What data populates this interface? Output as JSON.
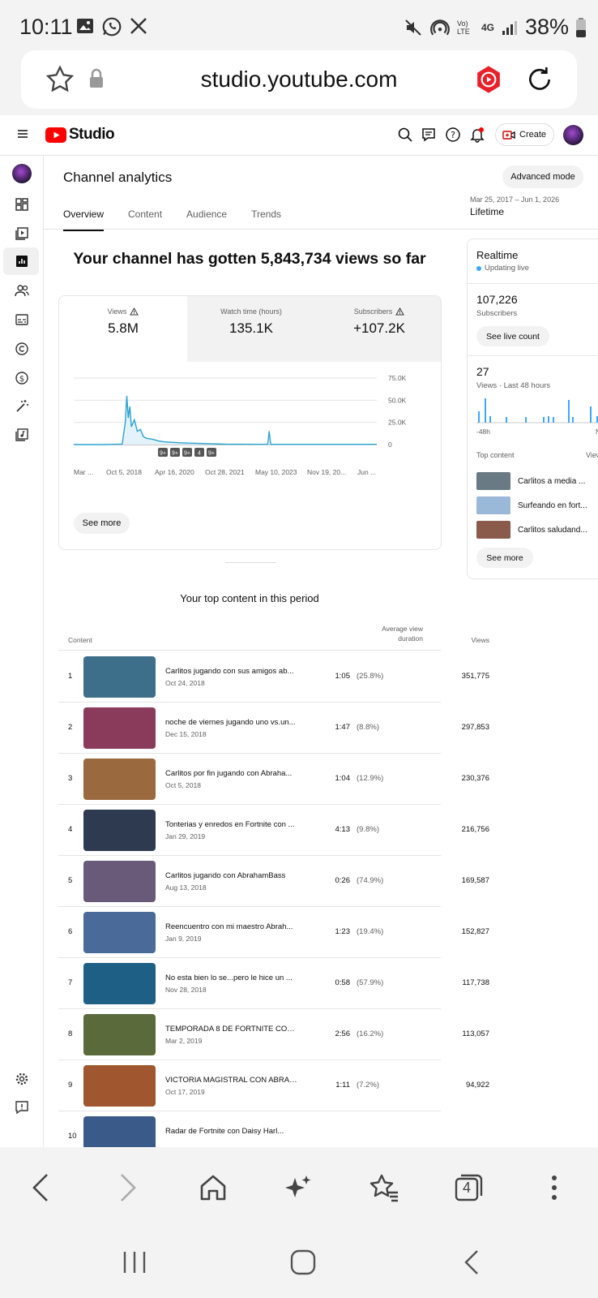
{
  "status_bar": {
    "time": "10:11",
    "battery": "38%",
    "network": "4G",
    "volte": "Vo) LTE"
  },
  "url_bar": {
    "url": "studio.youtube.com"
  },
  "header": {
    "logo_text": "Studio",
    "create_label": "Create"
  },
  "page": {
    "title": "Channel analytics",
    "advanced_mode": "Advanced mode",
    "tabs": [
      "Overview",
      "Content",
      "Audience",
      "Trends"
    ],
    "date_range": "Mar 25, 2017 – Jun 1, 2026",
    "range_label": "Lifetime",
    "headline": "Your channel has gotten 5,843,734 views so far"
  },
  "metrics": [
    {
      "label": "Views",
      "value": "5.8M"
    },
    {
      "label": "Watch time (hours)",
      "value": "135.1K"
    },
    {
      "label": "Subscribers",
      "value": "+107.2K"
    }
  ],
  "chart_data": {
    "type": "line",
    "title": "",
    "xlabel": "",
    "ylabel": "",
    "y_ticks": [
      "75.0K",
      "50.0K",
      "25.0K",
      "0"
    ],
    "ylim": [
      0,
      75000
    ],
    "x_ticks": [
      "Mar ...",
      "Oct 5, 2018",
      "Apr 16, 2020",
      "Oct 28, 2021",
      "May 10, 2023",
      "Nov 19, 20...",
      "Jun ..."
    ],
    "markers": [
      "9+",
      "9+",
      "9+",
      "4",
      "9+"
    ],
    "x": [
      0,
      0.1,
      0.16,
      0.17,
      0.175,
      0.18,
      0.185,
      0.19,
      0.2,
      0.21,
      0.22,
      0.23,
      0.24,
      0.26,
      0.28,
      0.3,
      0.35,
      0.4,
      0.5,
      0.6,
      0.64,
      0.645,
      0.65,
      0.7,
      0.8,
      0.9,
      1.0
    ],
    "values": [
      0,
      0,
      500,
      25000,
      55000,
      30000,
      43000,
      20000,
      28000,
      15000,
      17000,
      9000,
      7000,
      6000,
      4000,
      3000,
      2000,
      1500,
      500,
      300,
      300,
      15000,
      300,
      300,
      300,
      300,
      300
    ]
  },
  "see_more": "See more",
  "realtime": {
    "title": "Realtime",
    "status": "Updating live",
    "subscribers_value": "107,226",
    "subscribers_label": "Subscribers",
    "see_live": "See live count",
    "views_value": "27",
    "views_label": "Views · Last 48 hours",
    "axis_left": "-48h",
    "axis_right": "No",
    "top_content_label": "Top content",
    "top_content_right": "View",
    "items": [
      {
        "title": "Carlitos a media ...",
        "color": "#6a7a84"
      },
      {
        "title": "Surfeando en fort...",
        "color": "#9ab8d8"
      },
      {
        "title": "Carlitos saludand...",
        "color": "#8a5a4a"
      }
    ],
    "see_more": "See more"
  },
  "top_content": {
    "heading": "Your top content in this period",
    "col_content": "Content",
    "col_avd": "Average view duration",
    "col_views": "Views",
    "rows": [
      {
        "num": "1",
        "title": "Carlitos jugando con sus amigos ab...",
        "date": "Oct 24, 2018",
        "avd": "1:05",
        "pct": "(25.8%)",
        "views": "351,775",
        "color": "#3d6f8a"
      },
      {
        "num": "2",
        "title": "noche de viernes jugando uno vs.un...",
        "date": "Dec 15, 2018",
        "avd": "1:47",
        "pct": "(8.8%)",
        "views": "297,853",
        "color": "#8a3a5a"
      },
      {
        "num": "3",
        "title": "Carlitos por fin jugando con Abraha...",
        "date": "Oct 5, 2018",
        "avd": "1:04",
        "pct": "(12.9%)",
        "views": "230,376",
        "color": "#9a6a3e"
      },
      {
        "num": "4",
        "title": "Tonterias y enredos en Fortnite con ...",
        "date": "Jan 29, 2019",
        "avd": "4:13",
        "pct": "(9.8%)",
        "views": "216,756",
        "color": "#2d3a4f"
      },
      {
        "num": "5",
        "title": "Carlitos jugando con AbrahamBass",
        "date": "Aug 13, 2018",
        "avd": "0:26",
        "pct": "(74.9%)",
        "views": "169,587",
        "color": "#6a5a7a"
      },
      {
        "num": "6",
        "title": "Reencuentro con mi maestro Abrah...",
        "date": "Jan 9, 2019",
        "avd": "1:23",
        "pct": "(19.4%)",
        "views": "152,827",
        "color": "#4a6a9a"
      },
      {
        "num": "7",
        "title": "No esta bien lo se...pero le hice un ...",
        "date": "Nov 28, 2018",
        "avd": "0:58",
        "pct": "(57.9%)",
        "views": "117,738",
        "color": "#1e5f86"
      },
      {
        "num": "8",
        "title": "TEMPORADA 8 DE FORTNITE CON ...",
        "date": "Mar 2, 2019",
        "avd": "2:56",
        "pct": "(16.2%)",
        "views": "113,057",
        "color": "#5a6a3a"
      },
      {
        "num": "9",
        "title": "VICTORIA MAGISTRAL CON ABRAH...",
        "date": "Oct 17, 2019",
        "avd": "1:11",
        "pct": "(7.2%)",
        "views": "94,922",
        "color": "#a0562e"
      },
      {
        "num": "10",
        "title": "Radar de Fortnite con Daisy Harl...",
        "date": "",
        "avd": "",
        "pct": "",
        "views": "",
        "color": "#3a5a8a"
      }
    ]
  },
  "toolbar": {
    "tabs_count": "4"
  }
}
